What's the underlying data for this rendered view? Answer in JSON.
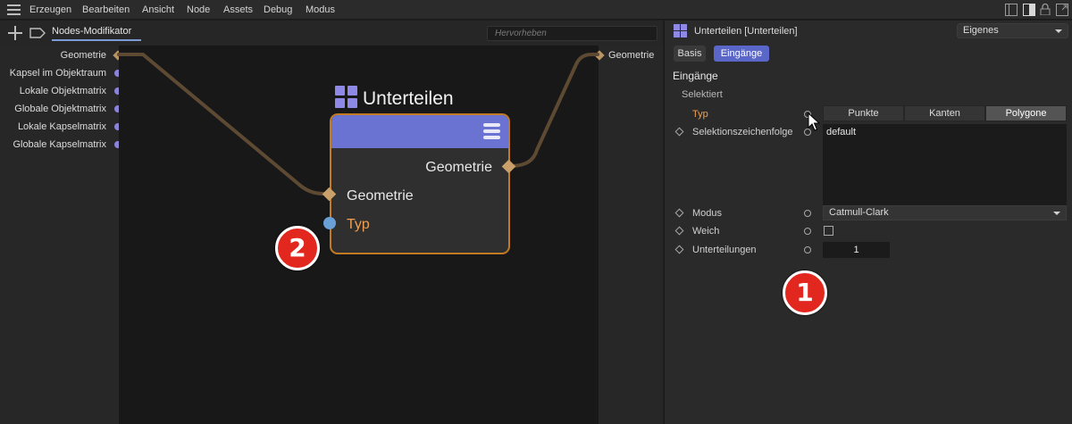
{
  "menubar": {
    "items": [
      "Erzeugen",
      "Bearbeiten",
      "Ansicht",
      "Node",
      "Assets",
      "Debug",
      "Modus"
    ],
    "window_icons": [
      "layout-icon",
      "panel-icon",
      "lock-icon",
      "expand-icon"
    ]
  },
  "editor": {
    "tab_label": "Nodes-Modifikator",
    "search_placeholder": "Hervorheben",
    "input_ports": [
      "Geometrie",
      "Kapsel im Objektraum",
      "Lokale Objektmatrix",
      "Globale Objektmatrix",
      "Lokale Kapselmatrix",
      "Globale Kapselmatrix"
    ],
    "output_port": "Geometrie",
    "node": {
      "title": "Unterteilen",
      "output": "Geometrie",
      "inputs": [
        "Geometrie",
        "Typ"
      ]
    },
    "badge": "2"
  },
  "attributes": {
    "title": "Unterteilen [Unterteilen]",
    "preset": "Eigenes",
    "tabs": [
      {
        "label": "Basis",
        "active": false
      },
      {
        "label": "Eingänge",
        "active": true
      }
    ],
    "section": "Eingänge",
    "subsection": "Selektiert",
    "properties": {
      "typ_label": "Typ",
      "typ_options": [
        "Punkte",
        "Kanten",
        "Polygone"
      ],
      "typ_selected": "Polygone",
      "selektion_label": "Selektionszeichenfolge",
      "selektion_value": "default",
      "modus_label": "Modus",
      "modus_value": "Catmull-Clark",
      "weich_label": "Weich",
      "weich_checked": false,
      "unterteilungen_label": "Unterteilungen",
      "unterteilungen_value": "1"
    },
    "badge": "1"
  },
  "colors": {
    "accent": "#5a66c8",
    "node_header": "#6a73d2",
    "node_border": "#c27a23",
    "wire": "#5e4a33",
    "port_orange": "#f0a050",
    "badge_red": "#e2271f"
  }
}
